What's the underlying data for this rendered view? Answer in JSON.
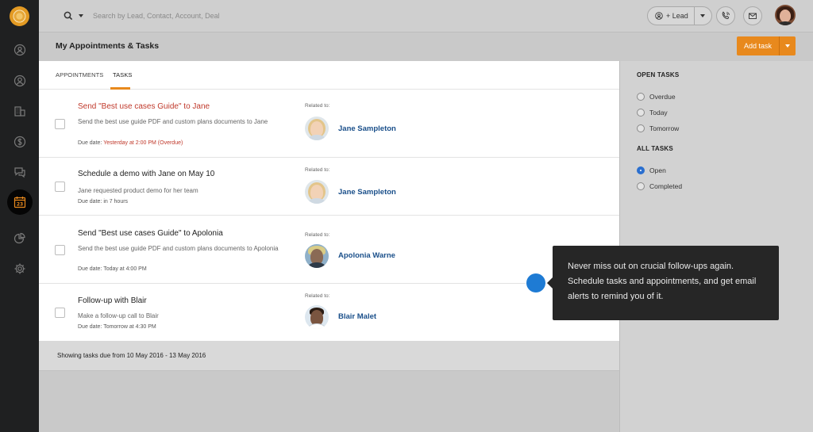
{
  "colors": {
    "accent": "#e8891d",
    "link": "#1a4f8a",
    "overdue": "#c0392b",
    "sidebar": "#1f2021",
    "hotspot": "#1e7bd4",
    "radio_checked": "#2a6fcf"
  },
  "sidebar": {
    "items": [
      {
        "icon": "contact-icon"
      },
      {
        "icon": "user-icon"
      },
      {
        "icon": "building-icon"
      },
      {
        "icon": "dollar-icon"
      },
      {
        "icon": "chat-icon"
      },
      {
        "icon": "calendar-icon",
        "label": "23",
        "active": true
      },
      {
        "icon": "pie-chart-icon"
      },
      {
        "icon": "gear-icon"
      }
    ]
  },
  "topbar": {
    "search_placeholder": "Search by Lead, Contact, Account, Deal",
    "lead_button": "+ Lead",
    "phone_icon": "phone-icon",
    "mail_icon": "mail-icon"
  },
  "page": {
    "title": "My Appointments & Tasks",
    "add_task": "Add task"
  },
  "tabs": [
    "APPOINTMENTS",
    "TASKS"
  ],
  "tasks": [
    {
      "title": "Send \"Best use cases Guide\" to Jane",
      "overdue": true,
      "description": "Send the best use guide PDF and custom plans documents to Jane",
      "due_label": "Due date: ",
      "due_value": "Yesterday at 2:00 PM (Overdue)",
      "related_label": "Related to:",
      "related_name": "Jane Sampleton"
    },
    {
      "title": "Schedule a demo with Jane on May 10",
      "overdue": false,
      "description": "Jane requested product demo for her team",
      "due_label": "Due date: ",
      "due_value": "in 7 hours",
      "related_label": "Related to:",
      "related_name": "Jane Sampleton"
    },
    {
      "title": "Send \"Best use cases Guide\" to Apolonia",
      "overdue": false,
      "description": "Send the best use guide PDF and custom plans documents to Apolonia",
      "due_label": "Due date: ",
      "due_value": "Today at 4:00 PM",
      "related_label": "Related to:",
      "related_name": "Apolonia Warne"
    },
    {
      "title": "Follow-up with Blair",
      "overdue": false,
      "description": "Make a follow-up call to Blair",
      "due_label": "Due date: ",
      "due_value": "Tomorrow at 4:30 PM",
      "related_label": "Related to:",
      "related_name": "Blair Malet"
    }
  ],
  "footer": {
    "text": "Showing tasks due from 10 May 2016 - 13 May 2016"
  },
  "filters": {
    "open_tasks_heading": "OPEN TASKS",
    "open_tasks": [
      "Overdue",
      "Today",
      "Tomorrow"
    ],
    "all_tasks_heading": "ALL TASKS",
    "all_tasks": [
      "Open",
      "Completed"
    ],
    "selected": "Open"
  },
  "tooltip": {
    "text": "Never miss out on crucial follow-ups again. Schedule tasks and appointments, and get email alerts to remind you of it."
  }
}
